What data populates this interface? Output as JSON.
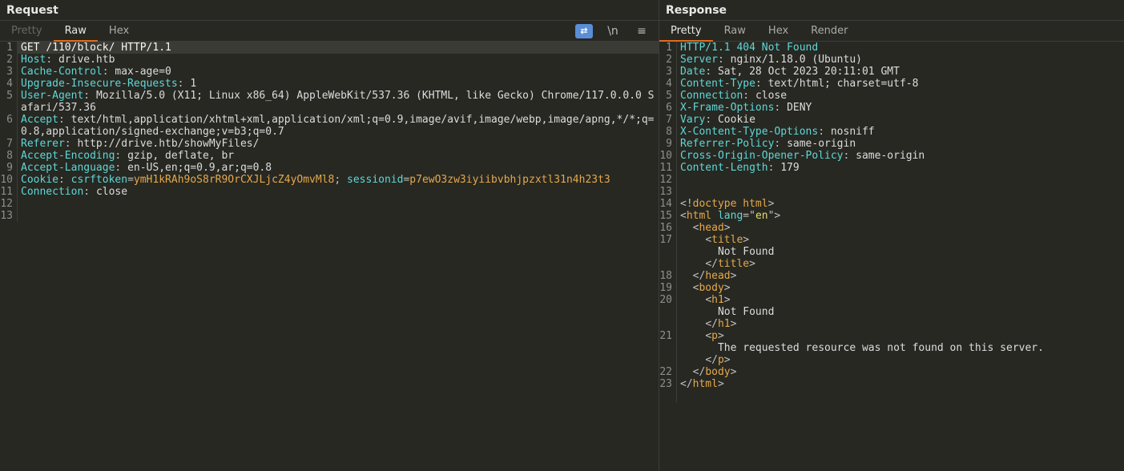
{
  "request": {
    "title": "Request",
    "tabs": {
      "pretty": "Pretty",
      "raw": "Raw",
      "hex": "Hex"
    },
    "active_tab": "raw",
    "toolbar": {
      "newline_label": "\\n",
      "wrap_label": "≡"
    },
    "lines": {
      "method": "GET",
      "path": "/110/block/",
      "protocol": "HTTP/1.1",
      "host_key": "Host",
      "host_val": "drive.htb",
      "cache_key": "Cache-Control",
      "cache_val": "max-age=0",
      "uir_key": "Upgrade-Insecure-Requests",
      "uir_val": "1",
      "ua_key": "User-Agent",
      "ua_val": "Mozilla/5.0 (X11; Linux x86_64) AppleWebKit/537.36 (KHTML, like Gecko) Chrome/117.0.0.0 Safari/537.36",
      "accept_key": "Accept",
      "accept_val": "text/html,application/xhtml+xml,application/xml;q=0.9,image/avif,image/webp,image/apng,*/*;q=0.8,application/signed-exchange;v=b3;q=0.7",
      "ref_key": "Referer",
      "ref_val": "http://drive.htb/showMyFiles/",
      "ae_key": "Accept-Encoding",
      "ae_val": "gzip, deflate, br",
      "al_key": "Accept-Language",
      "al_val": "en-US,en;q=0.9,ar;q=0.8",
      "cookie_key": "Cookie",
      "csrf_name": "csrftoken",
      "csrf_val": "ymH1kRAh9oS8rR9OrCXJLjcZ4yOmvMl8",
      "sess_name": "sessionid",
      "sess_val": "p7ewO3zw3iyiibvbhjpzxtl31n4h23t3",
      "conn_key": "Connection",
      "conn_val": "close"
    }
  },
  "response": {
    "title": "Response",
    "tabs": {
      "pretty": "Pretty",
      "raw": "Raw",
      "hex": "Hex",
      "render": "Render"
    },
    "active_tab": "pretty",
    "headers": {
      "status": "HTTP/1.1 404 Not Found",
      "server_key": "Server",
      "server_val": "nginx/1.18.0 (Ubuntu)",
      "date_key": "Date",
      "date_val": "Sat, 28 Oct 2023 20:11:01 GMT",
      "ct_key": "Content-Type",
      "ct_val": "text/html; charset=utf-8",
      "conn_key": "Connection",
      "conn_val": "close",
      "xfo_key": "X-Frame-Options",
      "xfo_val": "DENY",
      "vary_key": "Vary",
      "vary_val": "Cookie",
      "xcto_key": "X-Content-Type-Options",
      "xcto_val": "nosniff",
      "rp_key": "Referrer-Policy",
      "rp_val": "same-origin",
      "coop_key": "Cross-Origin-Opener-Policy",
      "coop_val": "same-origin",
      "cl_key": "Content-Length",
      "cl_val": "179"
    },
    "body": {
      "doctype": "doctype html",
      "html": "html",
      "lang_attr": "lang",
      "lang_val": "en",
      "head": "head",
      "title": "title",
      "title_text": "Not Found",
      "body_tag": "body",
      "h1": "h1",
      "h1_text": "Not Found",
      "p": "p",
      "p_text": "The requested resource was not found on this server."
    }
  },
  "linenums": [
    "1",
    "2",
    "3",
    "4",
    "5",
    "6",
    "7",
    "8",
    "9",
    "10",
    "11",
    "12",
    "13",
    "14",
    "15",
    "16",
    "17",
    "18",
    "19",
    "20",
    "21",
    "22",
    "23"
  ]
}
